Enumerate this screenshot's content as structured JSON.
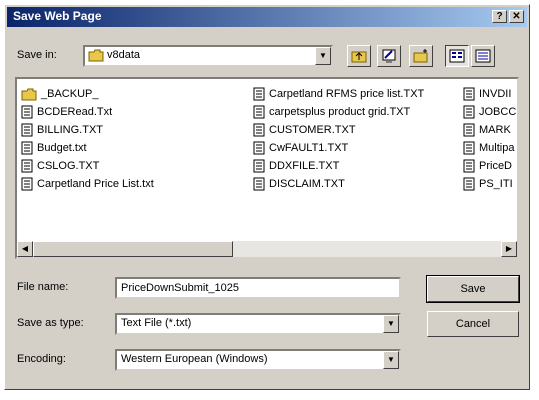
{
  "window": {
    "title": "Save Web Page",
    "help_btn": "?",
    "close_btn": "✕"
  },
  "save_in": {
    "label": "Save in:",
    "value": "v8data"
  },
  "toolbar": {
    "icons": [
      "up-one-level-icon",
      "desktop-icon",
      "new-folder-icon",
      "list-view-icon",
      "details-view-icon"
    ]
  },
  "files": {
    "col1": [
      "_BACKUP_",
      "BCDERead.Txt",
      "BILLING.TXT",
      "Budget.txt",
      "CSLOG.TXT",
      "Carpetland Price List.txt"
    ],
    "col2": [
      "Carpetland RFMS price list.TXT",
      "carpetsplus product grid.TXT",
      "CUSTOMER.TXT",
      "CwFAULT1.TXT",
      "DDXFILE.TXT",
      "DISCLAIM.TXT"
    ],
    "col3": [
      "INVDII",
      "JOBCC",
      "MARK",
      "Multipa",
      "PriceD",
      "PS_ITI"
    ]
  },
  "file_name": {
    "label": "File name:",
    "value": "PriceDownSubmit_1025"
  },
  "save_as_type": {
    "label": "Save as type:",
    "value": "Text File (*.txt)"
  },
  "encoding": {
    "label": "Encoding:",
    "value": "Western European (Windows)"
  },
  "buttons": {
    "save": "Save",
    "cancel": "Cancel"
  }
}
